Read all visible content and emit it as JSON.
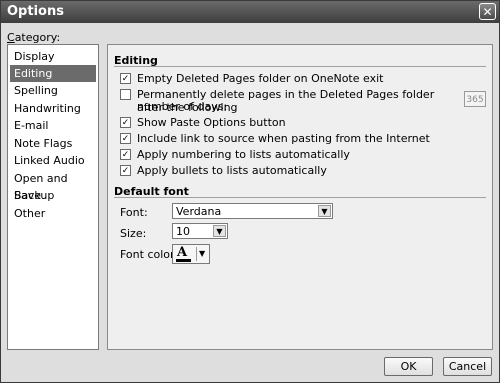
{
  "window": {
    "title": "Options",
    "close_glyph": "✕"
  },
  "category": {
    "label_first": "C",
    "label_rest": "ategory:",
    "items": [
      "Display",
      "Editing",
      "Spelling",
      "Handwriting",
      "E-mail",
      "Note Flags",
      "Linked Audio",
      "Open and Save",
      "Backup",
      "Other"
    ],
    "selected": "Editing"
  },
  "editing": {
    "heading": "Editing",
    "options": [
      {
        "label": "Empty Deleted Pages folder on OneNote exit",
        "checked": true
      },
      {
        "label": "Permanently delete pages in the Deleted Pages folder after the following",
        "label2": "number of days:",
        "checked": false
      },
      {
        "label": "Show Paste Options button",
        "checked": true
      },
      {
        "label": "Include link to source when pasting from the Internet",
        "checked": true
      },
      {
        "label": "Apply numbering to lists automatically",
        "checked": true
      },
      {
        "label": "Apply bullets to lists automatically",
        "checked": true
      }
    ],
    "days_value": "365"
  },
  "default_font": {
    "heading": "Default font",
    "font_label": "Font:",
    "font_value": "Verdana",
    "size_label": "Size:",
    "size_value": "10",
    "color_label": "Font color:",
    "color_glyph": "A",
    "dropdown_glyph": "▼"
  },
  "buttons": {
    "ok": "OK",
    "cancel": "Cancel"
  },
  "colors": {
    "titlebar": "#4a4a4a",
    "selected_item": "#6b6b6b",
    "dialog_bg": "#dedede"
  }
}
